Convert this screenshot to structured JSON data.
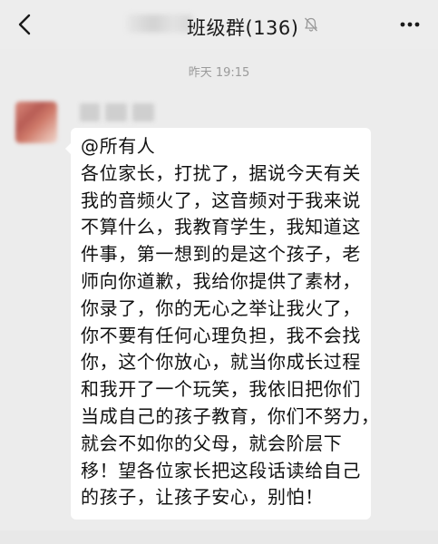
{
  "header": {
    "title": "班级群(136)",
    "back_icon": "chevron-left-icon",
    "mute_icon": "bell-off-icon",
    "more_icon": "more-dots-icon"
  },
  "chat": {
    "timestamp": "昨天 19:15",
    "message": {
      "lines": [
        "@所有人",
        "各位家长，打扰了，据说今天有关",
        "我的音频火了，这音频对于我来说",
        "不算什么，我教育学生，我知道这",
        "件事，第一想到的是这个孩子，老",
        "师向你道歉，我给你提供了素材，",
        "你录了，你的无心之举让我火了，",
        "你不要有任何心理负担，我不会找",
        "你，这个你放心，就当你成长过程",
        "和我开了一个玩笑，我依旧把你们",
        "当成自己的孩子教育，你们不努力，",
        "就会不如你的父母，就会阶层下",
        "移！望各位家长把这段话读给自己",
        "的孩子，让孩子安心，别怕！"
      ]
    }
  },
  "colors": {
    "background": "#ececec",
    "bubble": "#ffffff",
    "timestamp": "#9a9a9a",
    "text": "#111111"
  }
}
